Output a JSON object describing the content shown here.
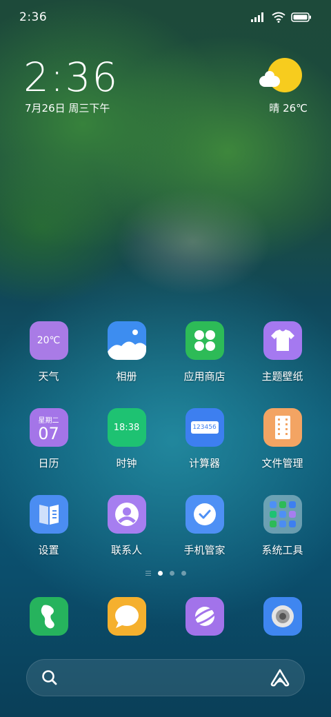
{
  "status_bar": {
    "time": "2:36",
    "signal_icon": "signal-icon",
    "wifi_icon": "wifi-icon",
    "battery_icon": "battery-icon"
  },
  "clock_widget": {
    "time": "2:36",
    "date": "7月26日 周三下午"
  },
  "weather_widget": {
    "icon": "sun-cloud-icon",
    "text": "晴 26℃"
  },
  "apps": [
    {
      "label": "天气",
      "icon": "weather-icon",
      "icon_text": "20℃",
      "color": "#a97be6"
    },
    {
      "label": "相册",
      "icon": "gallery-icon",
      "color": "#3d8df0"
    },
    {
      "label": "应用商店",
      "icon": "app-store-icon",
      "color": "#2dbb57"
    },
    {
      "label": "主题壁纸",
      "icon": "theme-shirt-icon",
      "color": "#a579f0"
    },
    {
      "label": "日历",
      "icon": "calendar-icon",
      "icon_weekday": "星期二",
      "icon_day": "07",
      "color": "#a475e8"
    },
    {
      "label": "时钟",
      "icon": "clock-icon",
      "icon_text": "18:38",
      "color": "#1ec272"
    },
    {
      "label": "计算器",
      "icon": "calculator-icon",
      "icon_text": "123456",
      "color": "#3d7ff0"
    },
    {
      "label": "文件管理",
      "icon": "file-manager-icon",
      "color": "#f3a463"
    },
    {
      "label": "设置",
      "icon": "settings-book-icon",
      "color": "#4b8df2"
    },
    {
      "label": "联系人",
      "icon": "contacts-icon",
      "color": "#a67ef0"
    },
    {
      "label": "手机管家",
      "icon": "phone-manager-icon",
      "color": "#4e90f5"
    },
    {
      "label": "系统工具",
      "icon": "system-tools-folder-icon",
      "color": "rgba(180,210,220,0.55)"
    }
  ],
  "page_indicator": {
    "pages": 3,
    "active": 1
  },
  "dock": [
    {
      "icon": "phone-icon",
      "color": "#26b35d"
    },
    {
      "icon": "messages-icon",
      "color": "#f5b02e"
    },
    {
      "icon": "browser-icon",
      "color": "#a273ea"
    },
    {
      "icon": "camera-icon",
      "color": "#3f86f0"
    }
  ],
  "search_bar": {
    "search_icon": "search-icon",
    "assistant_icon": "assistant-icon"
  }
}
